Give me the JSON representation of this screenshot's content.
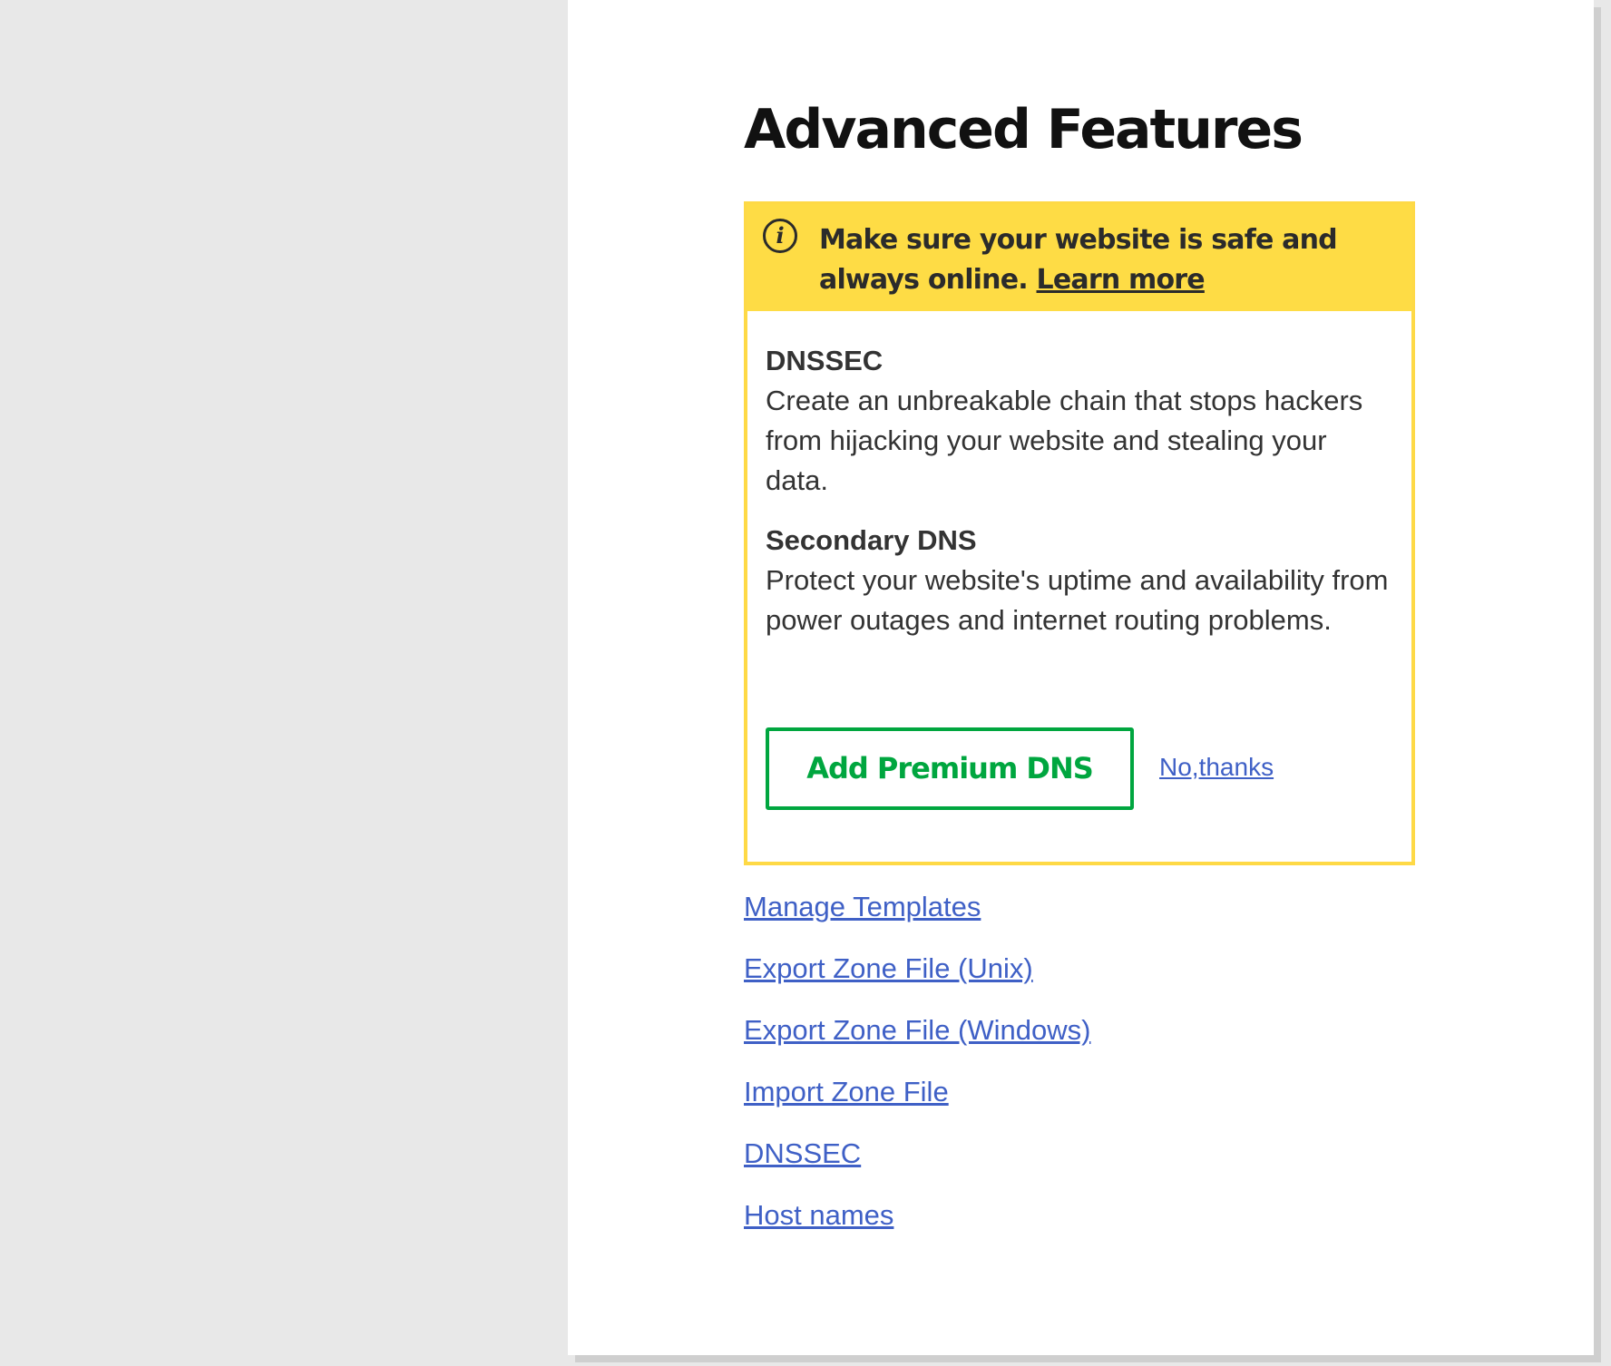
{
  "page": {
    "title": "Advanced Features"
  },
  "promo": {
    "icon": "info-icon",
    "icon_glyph": "i",
    "banner_text": "Make sure your website is safe and always online.",
    "learn_more": "Learn more",
    "features": [
      {
        "title": "DNSSEC",
        "description": "Create an unbreakable chain that stops hackers from hijacking your website and stealing your data."
      },
      {
        "title": "Secondary DNS",
        "description": "Protect your website's uptime and availability from power outages and internet routing problems."
      }
    ],
    "add_button_label": "Add Premium DNS",
    "no_thanks_label": "No,thanks",
    "colors": {
      "banner": "#fedc45",
      "border": "#fed946",
      "button": "#00a63f",
      "link": "#3f60c6"
    }
  },
  "links": [
    "Manage Templates",
    "Export Zone File (Unix)",
    "Export Zone File (Windows)",
    "Import Zone File",
    "DNSSEC",
    "Host names"
  ]
}
